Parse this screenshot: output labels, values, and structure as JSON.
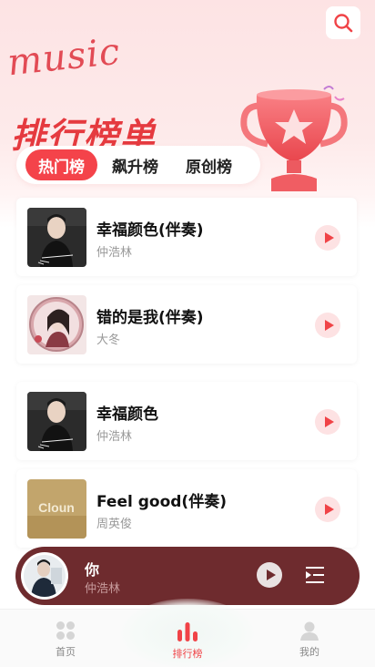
{
  "header": {
    "script_logo": "music",
    "title": "排行榜单",
    "search_icon": "search-icon",
    "accent_color": "#f4434a"
  },
  "tabs": [
    {
      "label": "热门榜",
      "active": true
    },
    {
      "label": "飙升榜",
      "active": false
    },
    {
      "label": "原创榜",
      "active": false
    }
  ],
  "songs": [
    {
      "title": "幸福颜色(伴奏)",
      "artist": "仲浩林",
      "cover": "portrait-dark"
    },
    {
      "title": "错的是我(伴奏)",
      "artist": "大冬",
      "cover": "portrait-circle"
    },
    {
      "title": "幸福颜色",
      "artist": "仲浩林",
      "cover": "portrait-dark"
    },
    {
      "title": "Feel good(伴奏)",
      "artist": "周英俊",
      "cover": "gold-clown"
    }
  ],
  "cover_texts": {
    "gold_clown": "Cloun"
  },
  "player": {
    "title": "你",
    "artist": "仲浩林",
    "background": "#6e2b2e"
  },
  "nav": [
    {
      "label": "首页",
      "icon": "grid-icon",
      "active": false
    },
    {
      "label": "排行榜",
      "icon": "bar-chart-icon",
      "active": true
    },
    {
      "label": "我的",
      "icon": "user-icon",
      "active": false
    }
  ]
}
